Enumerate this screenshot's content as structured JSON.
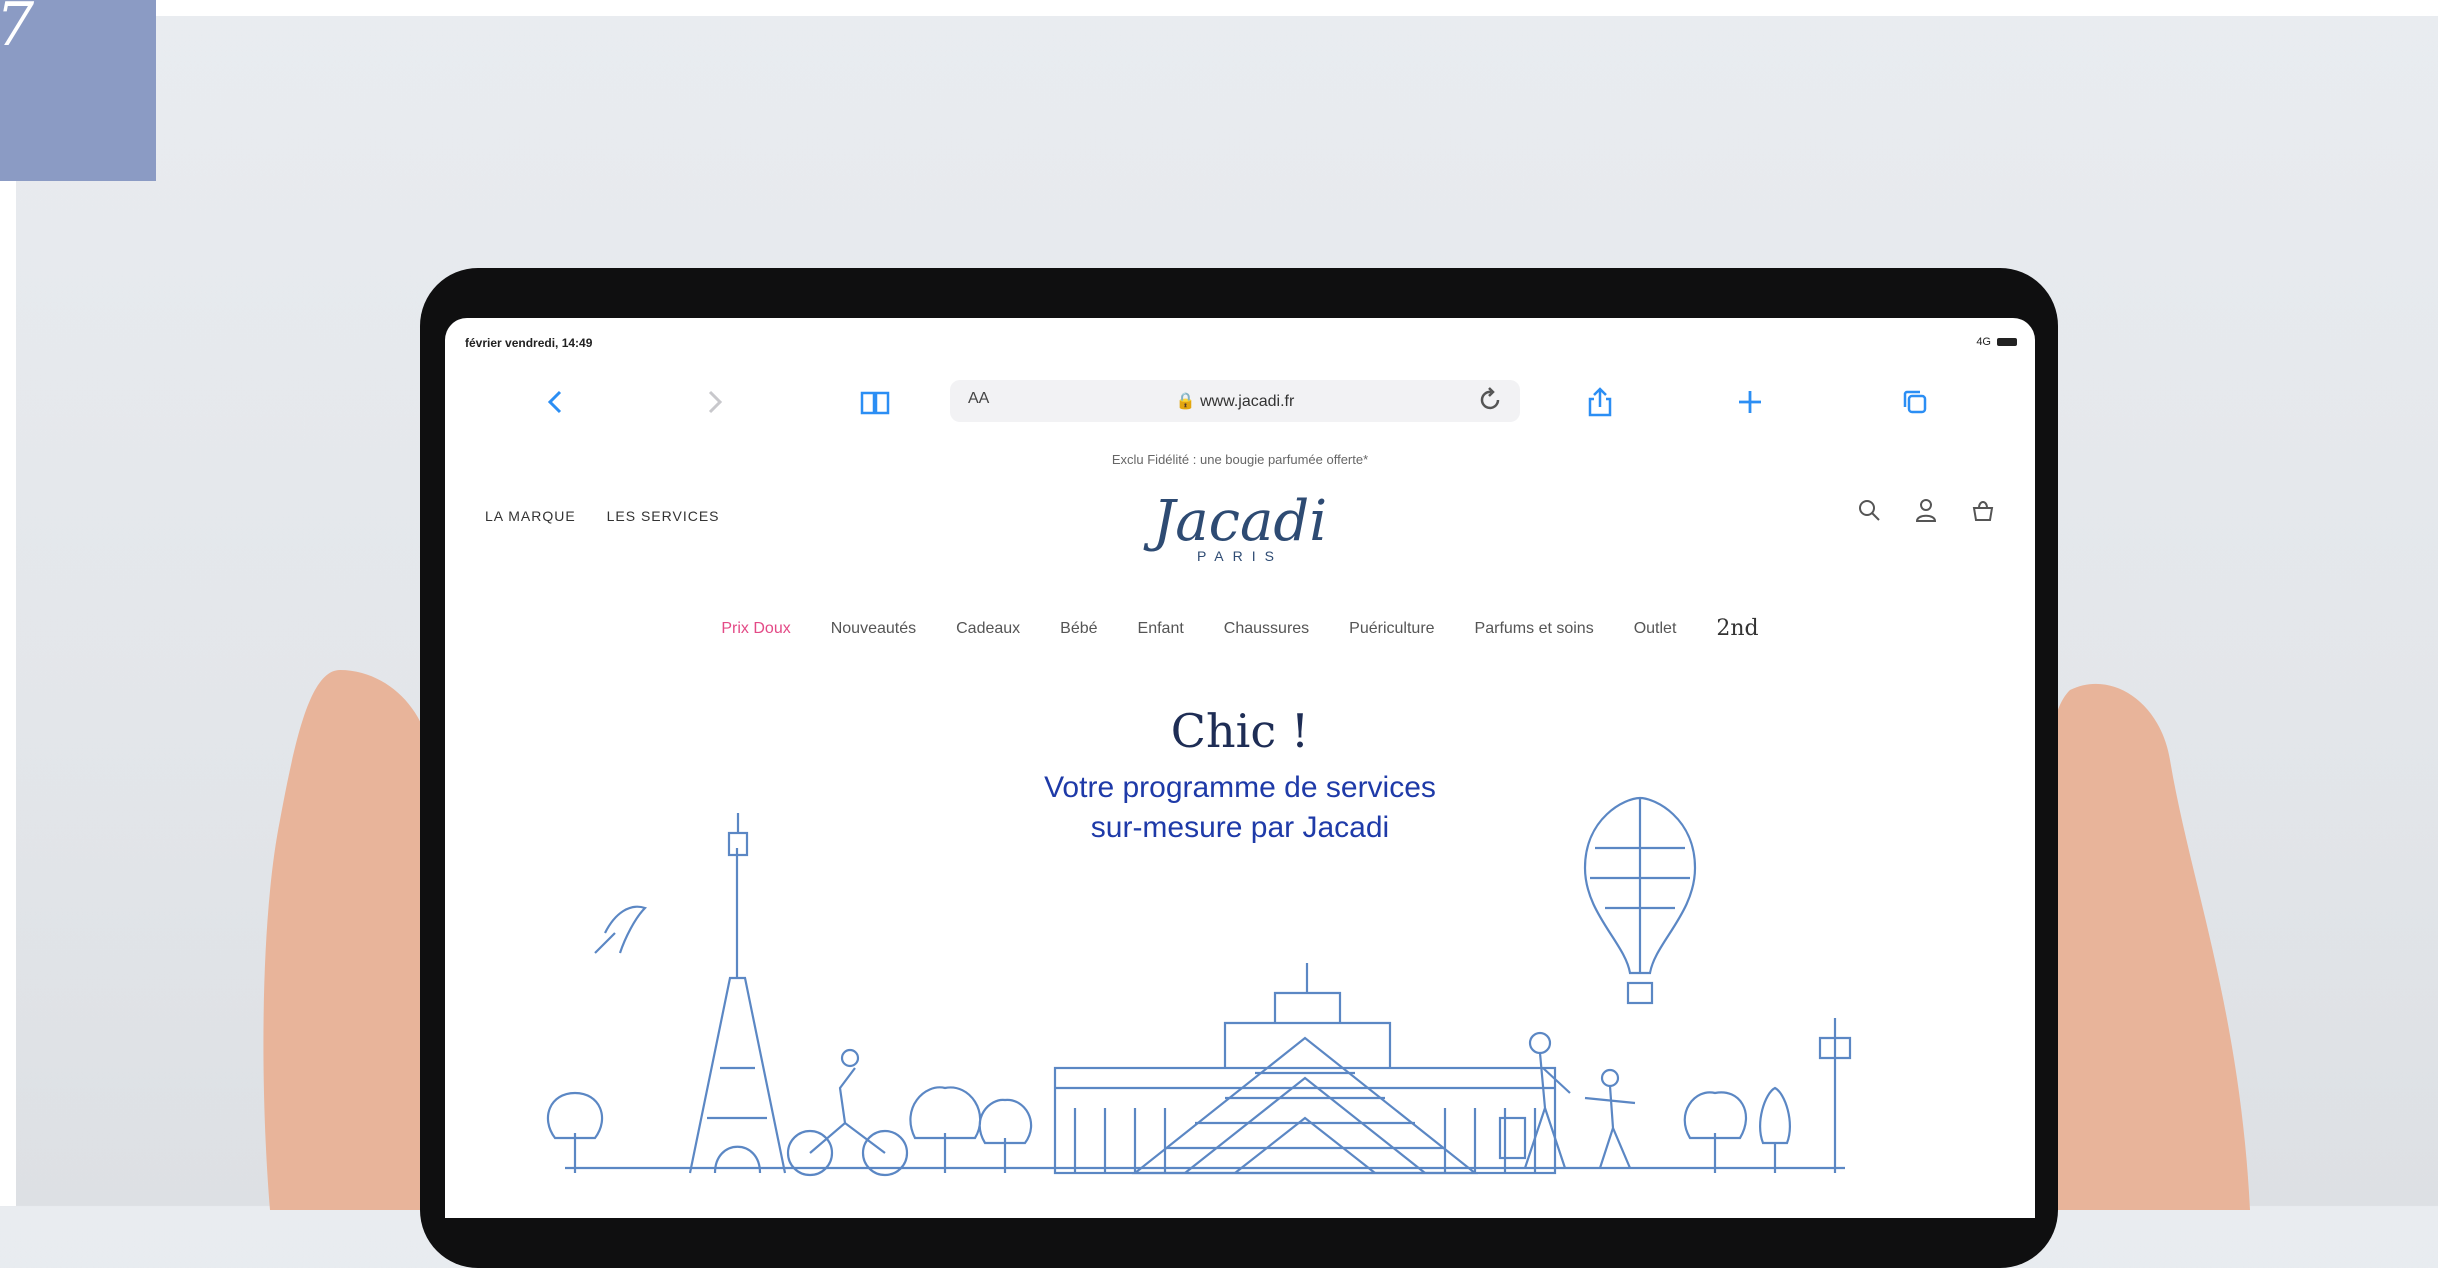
{
  "corner_tab": {
    "glyph": "7"
  },
  "statusbar": {
    "datetime": "février vendredi, 14:49",
    "signal": "4G"
  },
  "browser": {
    "back_icon": "chevron-left-icon",
    "forward_icon": "chevron-right-icon",
    "bookmarks_icon": "book-icon",
    "aa_label": "AA",
    "url": "www.jacadi.fr",
    "reload_icon": "reload-icon",
    "share_icon": "share-icon",
    "new_tab_icon": "plus-icon",
    "tabs_icon": "tabs-icon"
  },
  "promo": {
    "text": "Exclu Fidélité : une bougie parfumée offerte*"
  },
  "header": {
    "left_links": [
      "LA MARQUE",
      "LES SERVICES"
    ],
    "logo_main": "Jacadi",
    "logo_sub": "PARIS"
  },
  "categories": [
    {
      "label": "Prix Doux"
    },
    {
      "label": "Nouveautés"
    },
    {
      "label": "Cadeaux"
    },
    {
      "label": "Bébé"
    },
    {
      "label": "Enfant"
    },
    {
      "label": "Chaussures"
    },
    {
      "label": "Puériculture"
    },
    {
      "label": "Parfums et soins"
    },
    {
      "label": "Outlet"
    },
    {
      "label": "2nd"
    }
  ],
  "hero": {
    "title": "Chic !",
    "subtitle_line1": "Votre programme de services",
    "subtitle_line2": "sur-mesure par Jacadi"
  },
  "colors": {
    "accent": "#2b8ef4",
    "hot": "#e34a86",
    "brand": "#2e4b73",
    "illustration": "#5b87c4"
  }
}
